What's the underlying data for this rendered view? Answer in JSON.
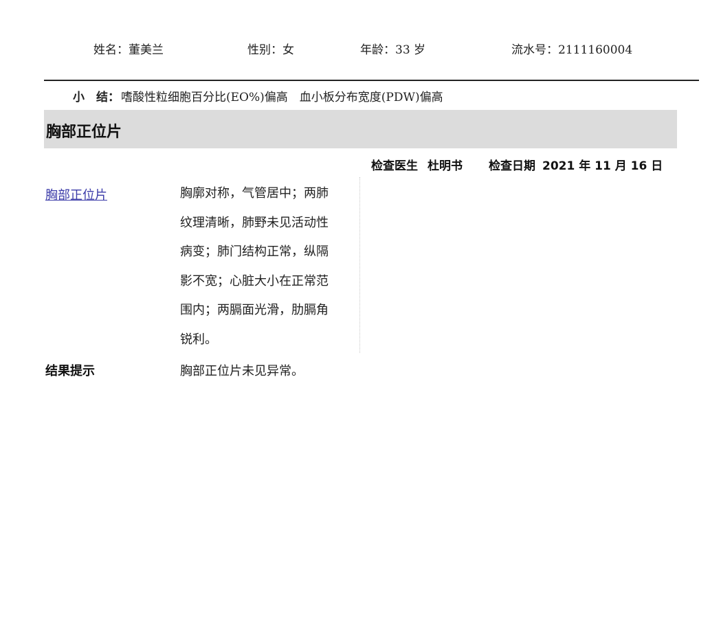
{
  "patient": {
    "name": "姓名：董美兰",
    "gender": "性别：女",
    "age": "年龄：33 岁",
    "serial": "流水号：2111160004"
  },
  "summary": {
    "label": "小　结：",
    "text": "嗜酸性粒细胞百分比(EO%)偏高　血小板分布宽度(PDW)偏高"
  },
  "section": {
    "title": "胸部正位片",
    "doctor_label": "检查医生",
    "doctor_name": "杜明书",
    "date_label": "检查日期",
    "date_value": "2021 年 11 月 16 日"
  },
  "exam_item": {
    "name": "胸部正位片",
    "findings_lines": [
      "胸廓对称，气管居中；两肺",
      "纹理清晰，肺野未见活动性",
      "病变；肺门结构正常，纵隔",
      "影不宽；心脏大小在正常范",
      "围内；两膈面光滑，肋膈角",
      "锐利。"
    ]
  },
  "result": {
    "label": "结果提示",
    "text": "胸部正位片未见异常。"
  },
  "colors": {
    "band": "#dcdcdc",
    "link": "#3a3aa8",
    "rule": "#222222"
  }
}
